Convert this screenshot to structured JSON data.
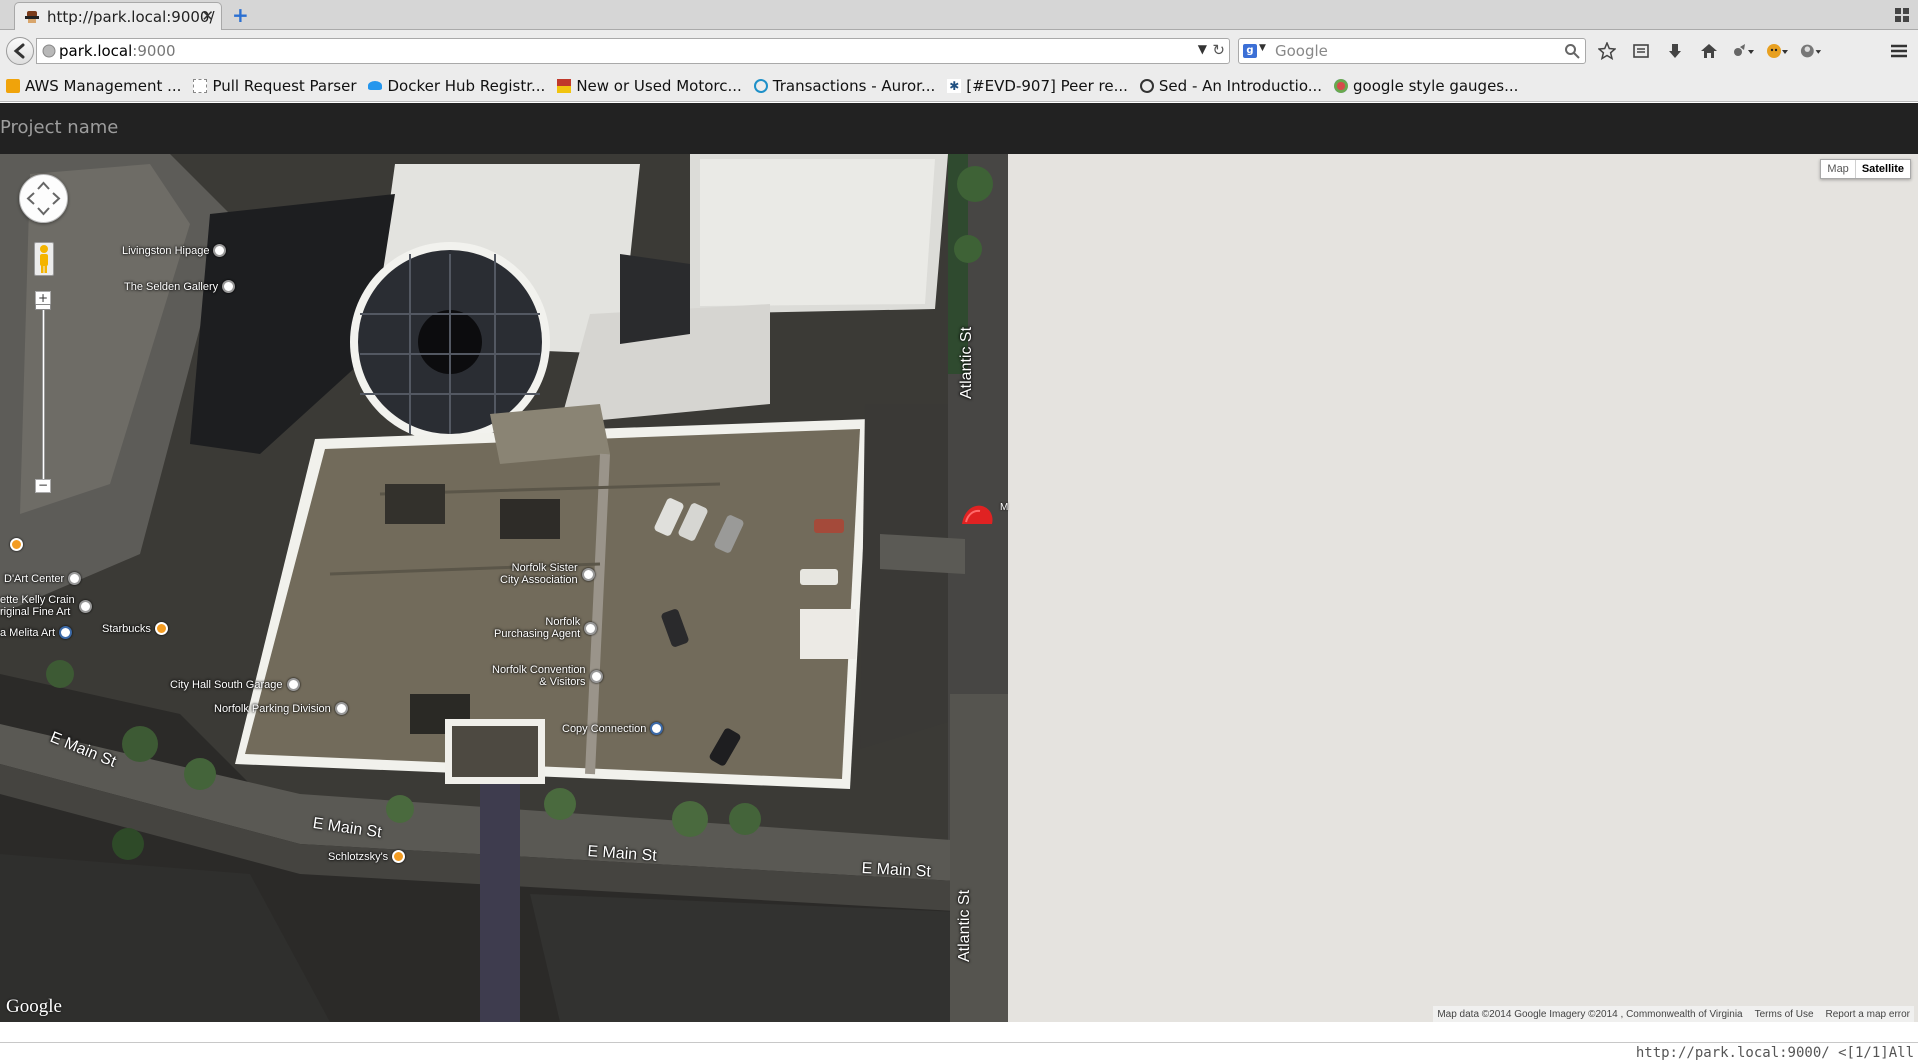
{
  "browser": {
    "tab_title": "http://park.local:9000/",
    "url_host": "park.local",
    "url_port": ":9000",
    "search_placeholder": "Google",
    "bookmarks": [
      {
        "label": "AWS Management ...",
        "icon": "aws-icon",
        "color": "#f0a30a"
      },
      {
        "label": "Pull Request Parser",
        "icon": "page-icon",
        "color": "#ffffff"
      },
      {
        "label": "Docker Hub Registr...",
        "icon": "docker-icon",
        "color": "#2496ed"
      },
      {
        "label": "New or Used Motorc...",
        "icon": "motorcycle-icon",
        "color": "#c0392b"
      },
      {
        "label": "Transactions - Auror...",
        "icon": "aurora-icon",
        "color": "#1e90c8"
      },
      {
        "label": "[#EVD-907] Peer re...",
        "icon": "jira-icon",
        "color": "#205081"
      },
      {
        "label": "Sed - An Introductio...",
        "icon": "sed-icon",
        "color": "#333333"
      },
      {
        "label": "google style gauges...",
        "icon": "gauges-icon",
        "color": "#d64b4b"
      }
    ]
  },
  "app": {
    "brand": "Project name"
  },
  "map": {
    "maptype_map": "Map",
    "maptype_satellite": "Satellite",
    "pois": {
      "livingston": "Livingston Hipage",
      "selden": "The Selden Gallery",
      "dart": "D'Art Center",
      "kelly1": "ette Kelly Crain",
      "kelly2": "riginal Fine Art",
      "melita": "a Melita Art",
      "starbucks": "Starbucks",
      "sister1": "Norfolk Sister",
      "sister2": "City Association",
      "purch1": "Norfolk",
      "purch2": "Purchasing Agent",
      "conv1": "Norfolk Convention",
      "conv2": "& Visitors",
      "cityhall": "City Hall South Garage",
      "parking": "Norfolk Parking Division",
      "copy": "Copy Connection",
      "schlotzsky": "Schlotzsky's"
    },
    "streets": {
      "atlantic_top": "Atlantic St",
      "atlantic_bottom": "Atlantic St",
      "emain_left": "E Main St",
      "emain_1": "E Main St",
      "emain_2": "E Main St",
      "emain_3": "E Main St"
    },
    "marker_label": "M",
    "google_logo": "Google",
    "attribution": "Map data ©2014 Google Imagery ©2014 , Commonwealth of Virginia",
    "terms": "Terms of Use",
    "report": "Report a map error"
  },
  "status": {
    "text": "http://park.local:9000/ <[1/1]All"
  }
}
